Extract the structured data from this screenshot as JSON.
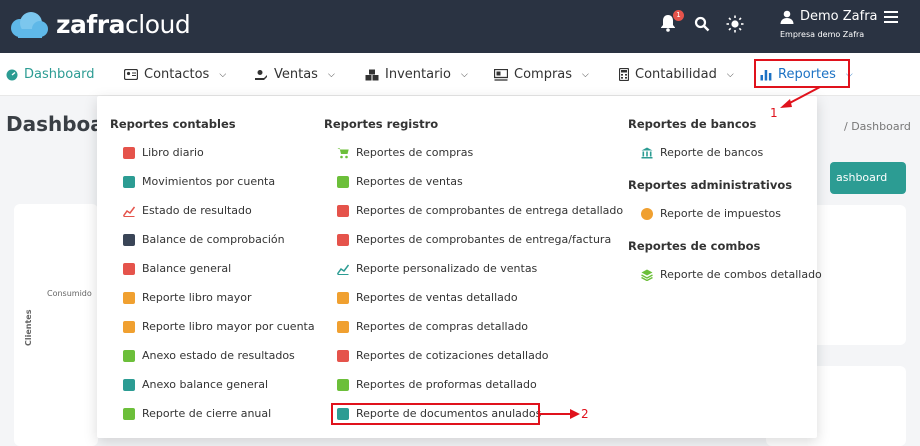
{
  "brand": {
    "name_bold": "zafra",
    "name_light": "cloud"
  },
  "header": {
    "notification_count": "1",
    "user_name": "Demo Zafra",
    "company": "Empresa demo Zafra"
  },
  "nav": {
    "items": [
      {
        "label": "Dashboard",
        "icon": "dashboard-icon"
      },
      {
        "label": "Contactos",
        "icon": "contacts-icon"
      },
      {
        "label": "Ventas",
        "icon": "sales-icon"
      },
      {
        "label": "Inventario",
        "icon": "inventory-icon"
      },
      {
        "label": "Compras",
        "icon": "cart-icon"
      },
      {
        "label": "Contabilidad",
        "icon": "accounting-icon"
      },
      {
        "label": "Reportes",
        "icon": "bar-chart-icon"
      }
    ]
  },
  "page": {
    "title": "Dashboa",
    "breadcrumb": "/  Dashboard",
    "button": "ashboard",
    "chart_y_label": "Clientes",
    "chart_series_label": "Consumido"
  },
  "dropdown": {
    "contables": {
      "heading": "Reportes contables",
      "items": [
        "Libro diario",
        "Movimientos por cuenta",
        "Estado de resultado",
        "Balance de comprobación",
        "Balance general",
        "Reporte libro mayor",
        "Reporte libro mayor por cuenta",
        "Anexo estado de resultados",
        "Anexo balance general",
        "Reporte de cierre anual"
      ]
    },
    "registro": {
      "heading": "Reportes registro",
      "items": [
        "Reportes de compras",
        "Reportes de ventas",
        "Reportes de comprobantes de entrega detallado",
        "Reportes de comprobantes de entrega/factura",
        "Reporte personalizado de ventas",
        "Reportes de ventas detallado",
        "Reportes de compras detallado",
        "Reportes de cotizaciones detallado",
        "Reportes de proformas detallado",
        "Reporte de documentos anulados"
      ]
    },
    "bancos": {
      "heading": "Reportes de bancos",
      "items": [
        "Reporte de bancos"
      ]
    },
    "administrativos": {
      "heading": "Reportes administrativos",
      "items": [
        "Reporte de impuestos"
      ]
    },
    "combos": {
      "heading": "Reportes de combos",
      "items": [
        "Reporte de combos detallado"
      ]
    }
  },
  "annotations": {
    "step1": "1",
    "step2": "2"
  },
  "colors": {
    "accent": "#2c9c93",
    "topbar": "#2a3342",
    "highlight": "#e0121c",
    "reportes": "#1c72c4"
  }
}
